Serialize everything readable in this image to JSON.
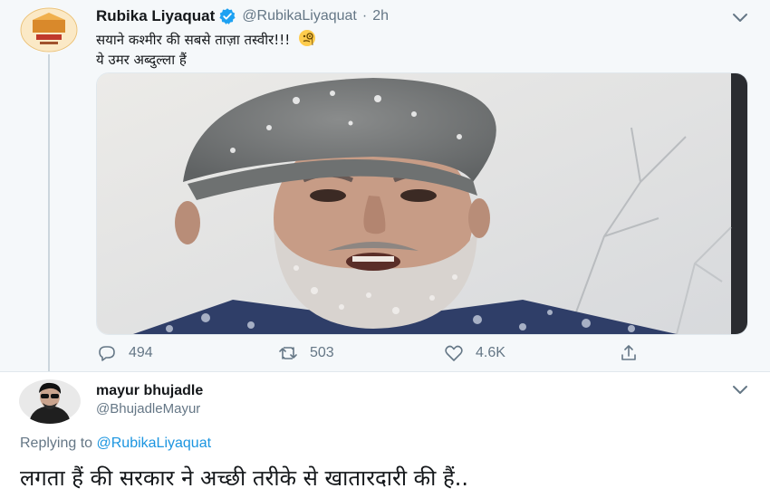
{
  "tweet": {
    "author_name": "Rubika Liyaquat",
    "author_handle": "@RubikaLiyaquat",
    "time": "2h",
    "line1": "सयाने कश्मीर की सबसे ताज़ा तस्वीर!!!",
    "line2": "ये उमर अब्दुल्ला हैं",
    "avatar_icon": "news-channel-logo",
    "emoji_icon": "face-with-monocle-emoji",
    "replies": "494",
    "retweets": "503",
    "likes": "4.6K"
  },
  "reply": {
    "author_name": "mayur bhujadle",
    "author_handle": "@BhujadleMayur",
    "replying_prefix": "Replying to",
    "replying_to": "@RubikaLiyaquat",
    "text": "लगता हैं की सरकार ने अच्छी तरीके से खातारदारी की हैं.."
  },
  "colors": {
    "secondary_text": "#657786",
    "link": "#1b95e0",
    "verified": "#1da1f2",
    "highlight_bg": "#f5f8fa"
  }
}
